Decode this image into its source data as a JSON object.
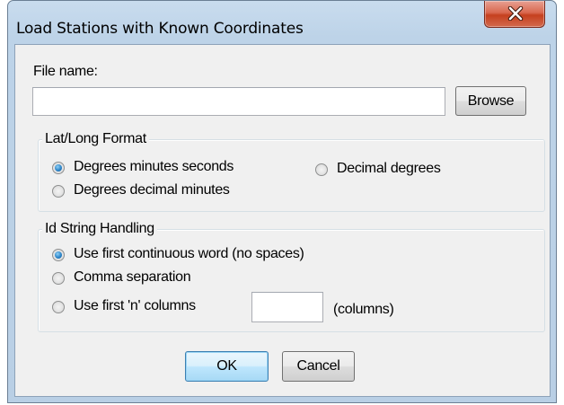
{
  "window": {
    "title": "Load Stations with Known Coordinates",
    "close_icon": "close-x-icon"
  },
  "file": {
    "label": "File name:",
    "value": "",
    "browse_label": "Browse"
  },
  "latlong": {
    "title": "Lat/Long Format",
    "options": [
      {
        "label": "Degrees minutes seconds",
        "checked": true
      },
      {
        "label": "Degrees decimal minutes",
        "checked": false
      },
      {
        "label": "Decimal degrees",
        "checked": false
      }
    ]
  },
  "idstring": {
    "title": "Id String Handling",
    "options": [
      {
        "label": "Use first continuous word (no spaces)",
        "checked": true
      },
      {
        "label": "Comma separation",
        "checked": false
      },
      {
        "label": "Use first 'n' columns",
        "checked": false
      }
    ],
    "columns_value": "",
    "columns_suffix": "(columns)"
  },
  "buttons": {
    "ok_label": "OK",
    "cancel_label": "Cancel"
  },
  "colors": {
    "title_bar": "#bdd3e8",
    "close_button": "#c5401f",
    "default_button": "#3c7fb1",
    "dialog_bg": "#f0f0f0"
  }
}
